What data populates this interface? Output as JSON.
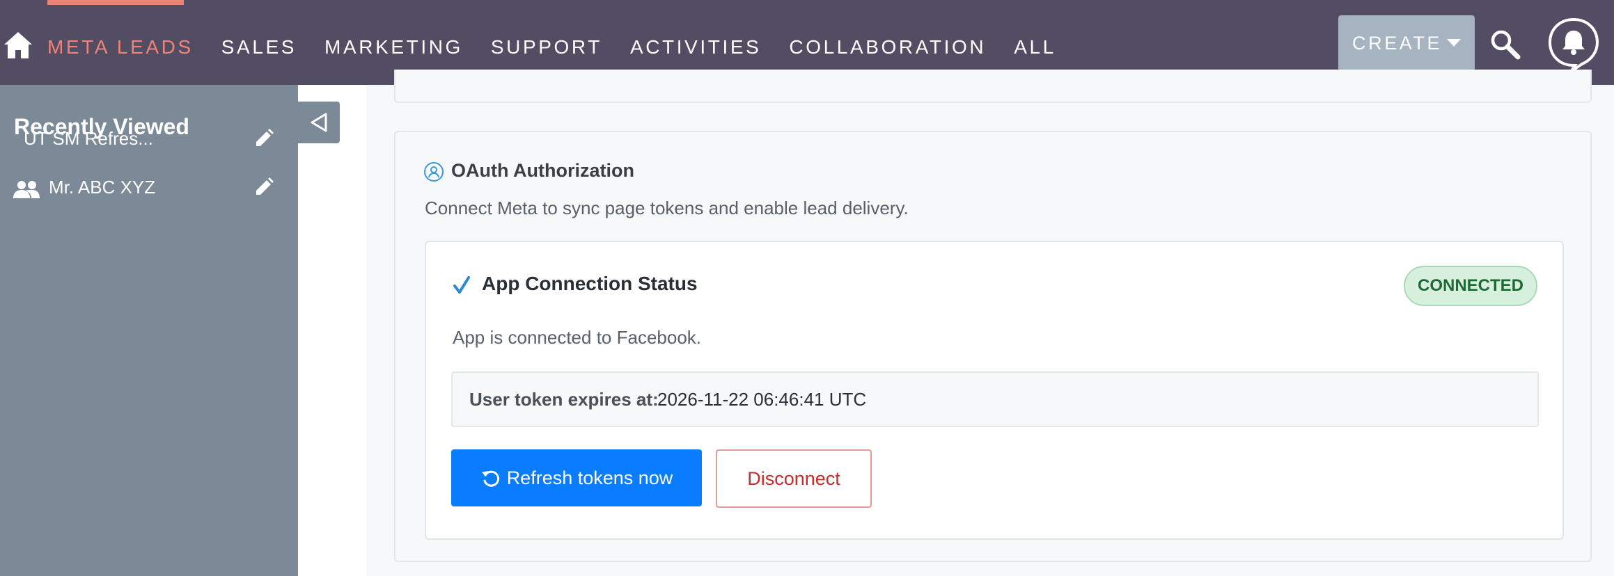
{
  "topbar": {
    "nav_items": [
      {
        "label": "META LEADS",
        "active": true
      },
      {
        "label": "SALES"
      },
      {
        "label": "MARKETING"
      },
      {
        "label": "SUPPORT"
      },
      {
        "label": "ACTIVITIES"
      },
      {
        "label": "COLLABORATION"
      },
      {
        "label": "ALL"
      }
    ],
    "create_label": "CREATE",
    "home_icon": "home-icon",
    "search_icon": "search-icon",
    "notifications_icon": "bell-icon"
  },
  "sidebar": {
    "title": "Recently Viewed",
    "items": [
      {
        "label": "UT SM Refres...",
        "icon": null
      },
      {
        "label": "Mr. ABC XYZ",
        "icon": "people-icon"
      }
    ]
  },
  "oauth": {
    "title": "OAuth Authorization",
    "description": "Connect Meta to sync page tokens and enable lead delivery.",
    "status": {
      "title": "App Connection Status",
      "badge": "CONNECTED",
      "description": "App is connected to Facebook.",
      "token_label": "User token expires at:",
      "token_value": "2026-11-22 06:46:41 UTC"
    },
    "refresh_label": "Refresh tokens now",
    "disconnect_label": "Disconnect"
  },
  "colors": {
    "topbar": "#534d64",
    "active_nav": "#f08377",
    "sidebar": "#7b8a96",
    "primary_button": "#0a7cff",
    "danger": "#c92a2a",
    "success_badge_bg": "#d6f0dd",
    "success_badge_text": "#1d6a36"
  }
}
